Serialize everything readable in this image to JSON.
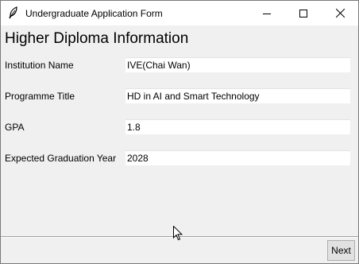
{
  "window": {
    "title": "Undergraduate Application Form",
    "app_icon": "feather-icon",
    "controls": [
      "minimize-icon",
      "maximize-icon",
      "close-icon"
    ]
  },
  "form": {
    "heading": "Higher Diploma Information",
    "fields": [
      {
        "label": "Institution Name",
        "value": "IVE(Chai Wan)"
      },
      {
        "label": "Programme Title",
        "value": "HD in AI and Smart Technology"
      },
      {
        "label": "GPA",
        "value": "1.8"
      },
      {
        "label": "Expected Graduation Year",
        "value": "2028"
      }
    ]
  },
  "footer": {
    "next_label": "Next"
  },
  "colors": {
    "background": "#f0f0f0",
    "titlebar": "#ffffff",
    "input": "#ffffff",
    "button": "#e1e1e1"
  }
}
